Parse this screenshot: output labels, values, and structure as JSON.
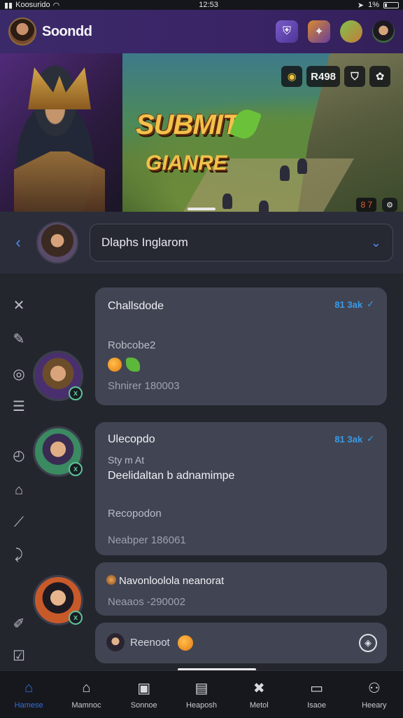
{
  "status_bar": {
    "carrier": "Koosurido",
    "time": "12:53",
    "battery": "1%"
  },
  "header": {
    "title": "Soondd",
    "icons": [
      "shield-icon",
      "treasure-icon",
      "friend-avatar-icon",
      "hero-avatar-icon"
    ]
  },
  "banner": {
    "logo_line1": "SUBMIT",
    "logo_line2": "GIANRE",
    "tag_coin": "◉",
    "tag_score": "R498",
    "tag_shield": "⛉",
    "tag_clover": "✿",
    "foot_value": "8 7"
  },
  "selector": {
    "back": "‹",
    "name": "Dlaphs Inglarom",
    "caret": "⌄"
  },
  "messages": [
    {
      "title": "Challsdode",
      "meta": "81 3ak",
      "sub": "Robcobe2",
      "stamp": "Shnirer 180003"
    },
    {
      "title": "Ulecopdo",
      "meta": "81 3ak",
      "sub": "Sty m At",
      "body": "Deelidaltan b adnamimpe",
      "note": "Recopodon",
      "stamp": "Neabper 186061"
    },
    {
      "title": "Navonloolola neanorat",
      "stamp": "Neaaos -290002"
    },
    {
      "title": "Reenoot"
    }
  ],
  "bottom_nav": [
    {
      "label": "Hamese",
      "icon": "home-icon",
      "active": true
    },
    {
      "label": "Mamnoc",
      "icon": "house-outline-icon",
      "active": false
    },
    {
      "label": "Sonnoe",
      "icon": "box-icon",
      "active": false
    },
    {
      "label": "Heaposh",
      "icon": "calendar-icon",
      "active": false
    },
    {
      "label": "Metol",
      "icon": "tools-icon",
      "active": false
    },
    {
      "label": "Isaoe",
      "icon": "tv-icon",
      "active": false
    },
    {
      "label": "Heeary",
      "icon": "user-icon",
      "active": false
    }
  ],
  "colors": {
    "accent": "#2f6fe0",
    "meta_blue": "#3a9be8",
    "header_purple": "#3b2a6a",
    "card_bg": "#414553"
  }
}
